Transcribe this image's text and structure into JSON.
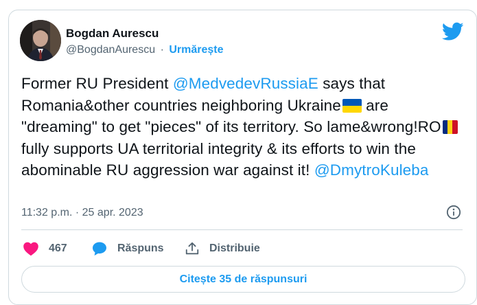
{
  "author": {
    "name": "Bogdan Aurescu",
    "handle": "@BogdanAurescu",
    "separator": "·",
    "follow_label": "Urmărește"
  },
  "tweet": {
    "p1": "Former RU President ",
    "mention1": "@MedvedevRussiaE",
    "p2": " says that Romania&other countries neighboring Ukraine",
    "p3": " are \"dreaming\" to get \"pieces\" of its territory. So lame&wrong!RO",
    "p4": " fully supports UA territorial integrity & its efforts to win the abominable RU aggression war against it! ",
    "mention2": "@DmytroKuleba"
  },
  "meta": {
    "time": "11:32 p.m.",
    "separator": "·",
    "date": "25 apr. 2023"
  },
  "actions": {
    "likes_count": "467",
    "reply_label": "Răspuns",
    "share_label": "Distribuie"
  },
  "replies_button_label": "Citește 35 de răspunsuri",
  "colors": {
    "accent": "#1d9bf0",
    "like": "#f91880",
    "secondary_text": "#536471",
    "border": "#cfd9de"
  },
  "icons": {
    "brand": "twitter-bird-icon",
    "info": "info-icon",
    "like": "heart-icon",
    "reply": "speech-bubble-icon",
    "share": "share-upload-icon"
  }
}
